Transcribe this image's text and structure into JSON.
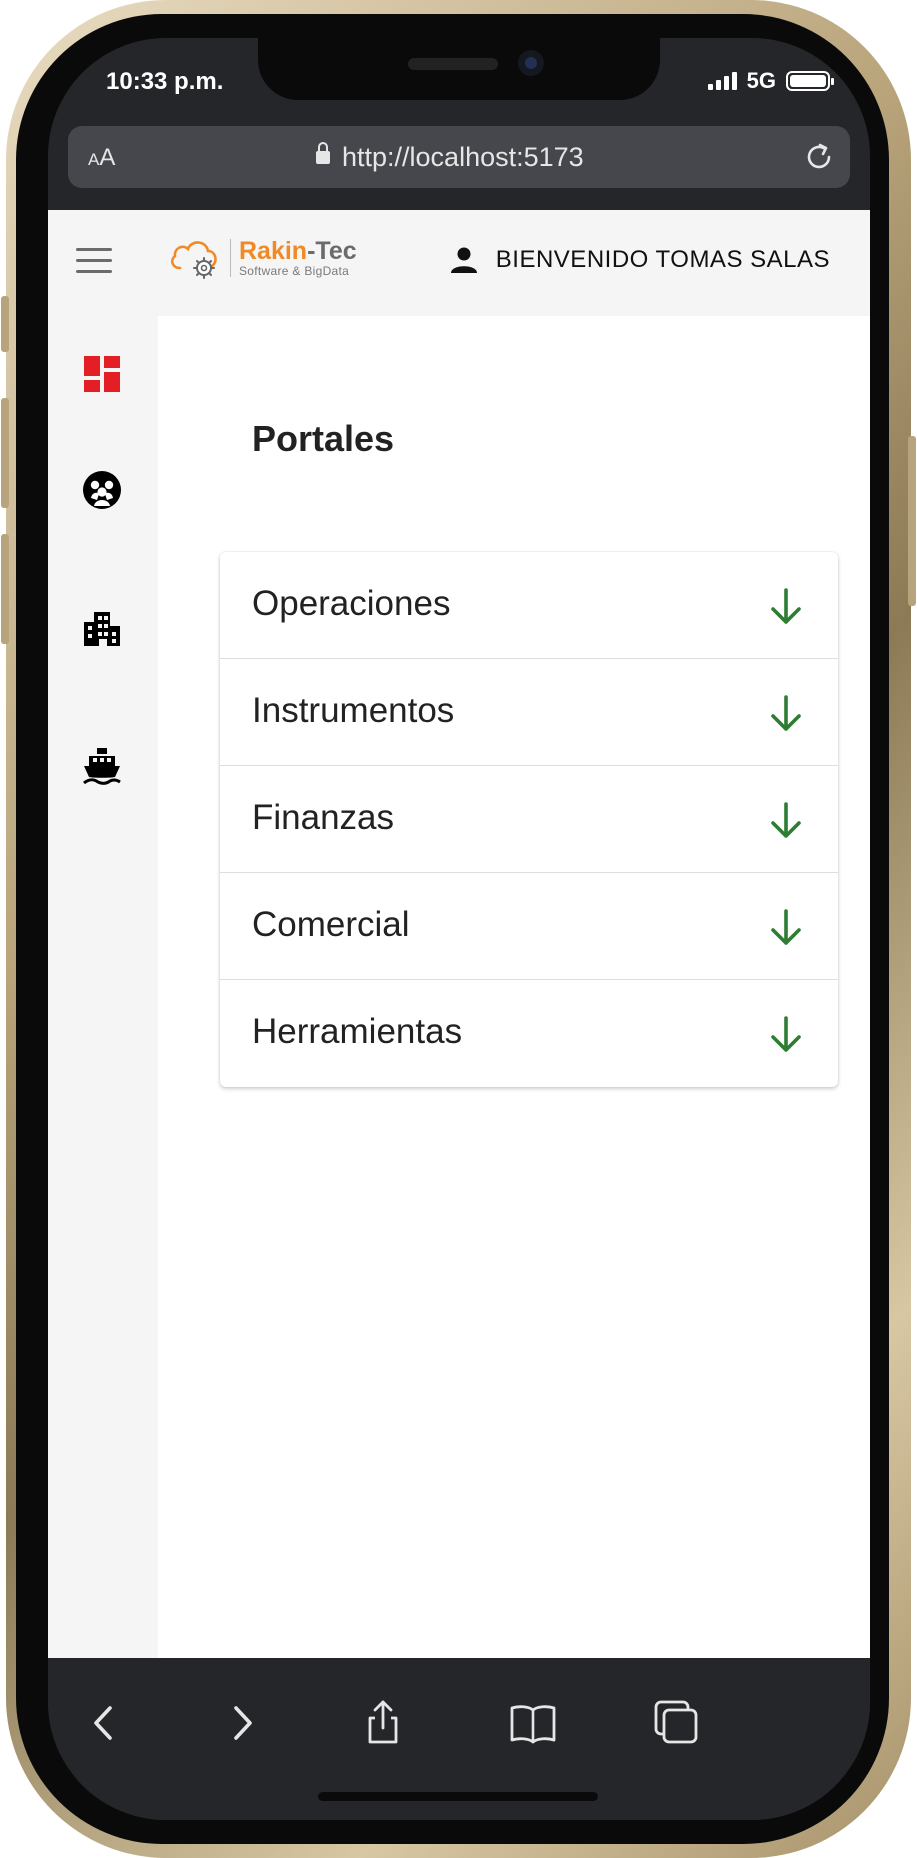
{
  "status_bar": {
    "time": "10:33 p.m.",
    "network": "5G",
    "battery_level": 1.0
  },
  "browser": {
    "text_size_label_small": "A",
    "text_size_label_large": "A",
    "url": "http://localhost:5173",
    "icons": {
      "lock": "lock-icon",
      "reload": "reload-icon",
      "back": "back-icon",
      "forward": "forward-icon",
      "share": "share-icon",
      "bookmarks": "bookmarks-icon",
      "tabs": "tabs-icon"
    }
  },
  "header": {
    "logo": {
      "name_part1": "Rakin",
      "name_part2": "-Tec",
      "tagline": "Software & BigData"
    },
    "welcome_text": "BIENVENIDO TOMAS SALAS",
    "icons": {
      "menu": "hamburger-menu-icon",
      "user": "user-icon"
    }
  },
  "sidebar": {
    "items": [
      {
        "icon": "dashboard-icon",
        "active": true
      },
      {
        "icon": "group-icon",
        "active": false
      },
      {
        "icon": "building-icon",
        "active": false
      },
      {
        "icon": "ship-icon",
        "active": false
      }
    ]
  },
  "main": {
    "title": "Portales",
    "portals": [
      {
        "label": "Operaciones"
      },
      {
        "label": "Instrumentos"
      },
      {
        "label": "Finanzas"
      },
      {
        "label": "Comercial"
      },
      {
        "label": "Herramientas"
      }
    ]
  },
  "colors": {
    "accent_red": "#e31e24",
    "arrow_green": "#2e7d32",
    "logo_orange": "#f08a24"
  }
}
